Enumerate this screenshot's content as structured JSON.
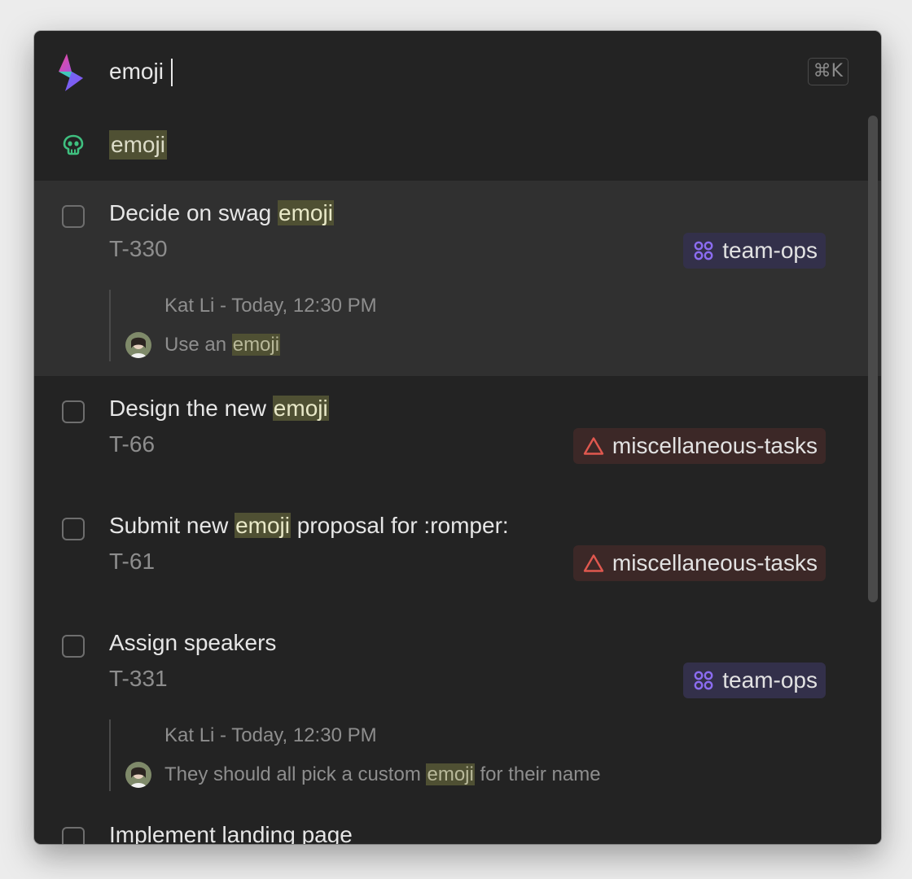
{
  "search": {
    "value": "emoji",
    "shortcut": "⌘K"
  },
  "emoji_result": {
    "label": "emoji"
  },
  "issues": [
    {
      "title_before": "Decide on swag ",
      "title_match": "emoji",
      "title_after": "",
      "id": "T-330",
      "tag": "team-ops",
      "tag_color": "#8b6cf0",
      "comment": {
        "meta": "Kat Li - Today, 12:30 PM",
        "before": "Use an ",
        "match": "emoji",
        "after": ""
      }
    },
    {
      "title_before": "Design the new ",
      "title_match": "emoji",
      "title_after": "",
      "id": "T-66",
      "tag": "miscellaneous-tasks",
      "tag_color": "#e0584f"
    },
    {
      "title_before": "Submit new ",
      "title_match": "emoji",
      "title_after": " proposal for :romper:",
      "id": "T-61",
      "tag": "miscellaneous-tasks",
      "tag_color": "#e0584f"
    },
    {
      "title_before": "Assign speakers",
      "title_match": "",
      "title_after": "",
      "id": "T-331",
      "tag": "team-ops",
      "tag_color": "#8b6cf0",
      "comment": {
        "meta": "Kat Li - Today, 12:30 PM",
        "before": "They should all pick a custom ",
        "match": "emoji",
        "after": " for their name"
      }
    },
    {
      "title_before": "Implement landing page",
      "title_match": "",
      "title_after": ""
    }
  ],
  "colors": {
    "background": "#232323",
    "selected_row": "#303030",
    "highlight": "#4f5033",
    "alien_icon": "#3fbf7f"
  }
}
